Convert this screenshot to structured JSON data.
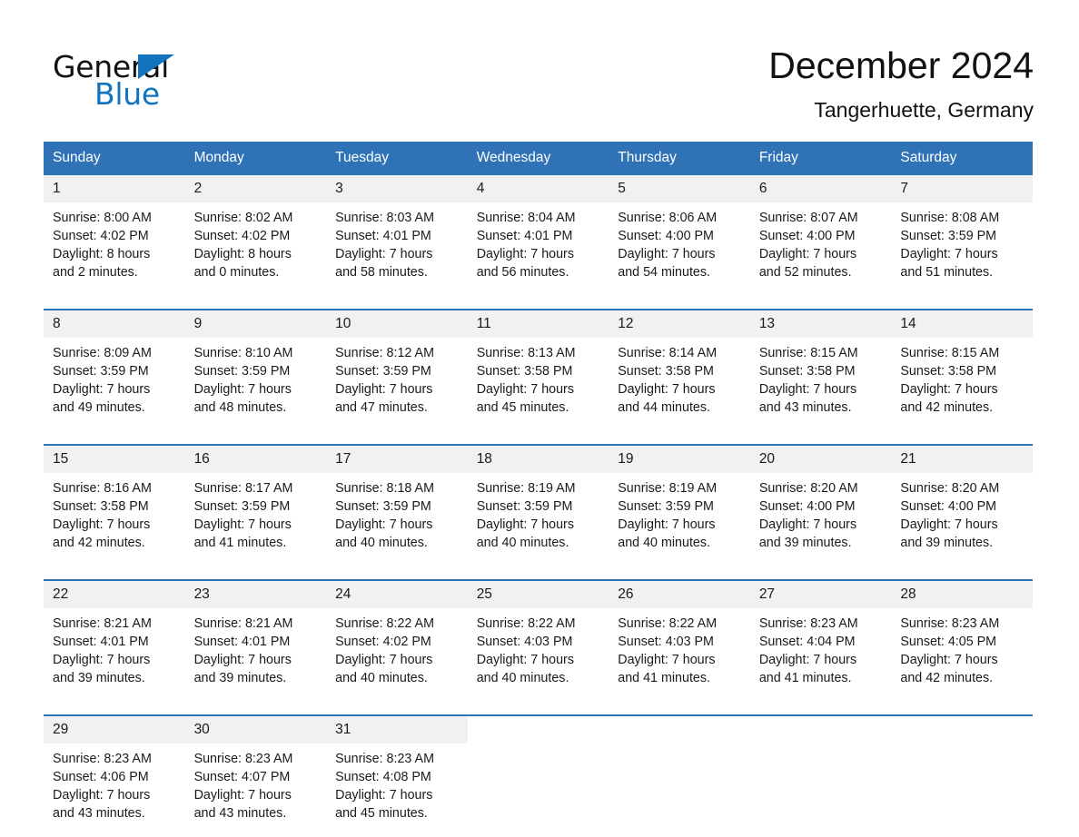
{
  "brand": {
    "name_top": "General",
    "name_bottom": "Blue",
    "triangle_color": "#1273be",
    "text_color": "#121212"
  },
  "header": {
    "title": "December 2024",
    "subtitle": "Tangerhuette, Germany"
  },
  "colors": {
    "header_blue": "#2f73b6",
    "daynum_band": "#f1f1f1",
    "text": "#1a1a1a",
    "page_background": "#ffffff"
  },
  "weekday_headers": [
    "Sunday",
    "Monday",
    "Tuesday",
    "Wednesday",
    "Thursday",
    "Friday",
    "Saturday"
  ],
  "weeks": [
    {
      "days": [
        {
          "num": "1",
          "sunrise": "Sunrise: 8:00 AM",
          "sunset": "Sunset: 4:02 PM",
          "daylight_1": "Daylight: 8 hours",
          "daylight_2": "and 2 minutes."
        },
        {
          "num": "2",
          "sunrise": "Sunrise: 8:02 AM",
          "sunset": "Sunset: 4:02 PM",
          "daylight_1": "Daylight: 8 hours",
          "daylight_2": "and 0 minutes."
        },
        {
          "num": "3",
          "sunrise": "Sunrise: 8:03 AM",
          "sunset": "Sunset: 4:01 PM",
          "daylight_1": "Daylight: 7 hours",
          "daylight_2": "and 58 minutes."
        },
        {
          "num": "4",
          "sunrise": "Sunrise: 8:04 AM",
          "sunset": "Sunset: 4:01 PM",
          "daylight_1": "Daylight: 7 hours",
          "daylight_2": "and 56 minutes."
        },
        {
          "num": "5",
          "sunrise": "Sunrise: 8:06 AM",
          "sunset": "Sunset: 4:00 PM",
          "daylight_1": "Daylight: 7 hours",
          "daylight_2": "and 54 minutes."
        },
        {
          "num": "6",
          "sunrise": "Sunrise: 8:07 AM",
          "sunset": "Sunset: 4:00 PM",
          "daylight_1": "Daylight: 7 hours",
          "daylight_2": "and 52 minutes."
        },
        {
          "num": "7",
          "sunrise": "Sunrise: 8:08 AM",
          "sunset": "Sunset: 3:59 PM",
          "daylight_1": "Daylight: 7 hours",
          "daylight_2": "and 51 minutes."
        }
      ]
    },
    {
      "days": [
        {
          "num": "8",
          "sunrise": "Sunrise: 8:09 AM",
          "sunset": "Sunset: 3:59 PM",
          "daylight_1": "Daylight: 7 hours",
          "daylight_2": "and 49 minutes."
        },
        {
          "num": "9",
          "sunrise": "Sunrise: 8:10 AM",
          "sunset": "Sunset: 3:59 PM",
          "daylight_1": "Daylight: 7 hours",
          "daylight_2": "and 48 minutes."
        },
        {
          "num": "10",
          "sunrise": "Sunrise: 8:12 AM",
          "sunset": "Sunset: 3:59 PM",
          "daylight_1": "Daylight: 7 hours",
          "daylight_2": "and 47 minutes."
        },
        {
          "num": "11",
          "sunrise": "Sunrise: 8:13 AM",
          "sunset": "Sunset: 3:58 PM",
          "daylight_1": "Daylight: 7 hours",
          "daylight_2": "and 45 minutes."
        },
        {
          "num": "12",
          "sunrise": "Sunrise: 8:14 AM",
          "sunset": "Sunset: 3:58 PM",
          "daylight_1": "Daylight: 7 hours",
          "daylight_2": "and 44 minutes."
        },
        {
          "num": "13",
          "sunrise": "Sunrise: 8:15 AM",
          "sunset": "Sunset: 3:58 PM",
          "daylight_1": "Daylight: 7 hours",
          "daylight_2": "and 43 minutes."
        },
        {
          "num": "14",
          "sunrise": "Sunrise: 8:15 AM",
          "sunset": "Sunset: 3:58 PM",
          "daylight_1": "Daylight: 7 hours",
          "daylight_2": "and 42 minutes."
        }
      ]
    },
    {
      "days": [
        {
          "num": "15",
          "sunrise": "Sunrise: 8:16 AM",
          "sunset": "Sunset: 3:58 PM",
          "daylight_1": "Daylight: 7 hours",
          "daylight_2": "and 42 minutes."
        },
        {
          "num": "16",
          "sunrise": "Sunrise: 8:17 AM",
          "sunset": "Sunset: 3:59 PM",
          "daylight_1": "Daylight: 7 hours",
          "daylight_2": "and 41 minutes."
        },
        {
          "num": "17",
          "sunrise": "Sunrise: 8:18 AM",
          "sunset": "Sunset: 3:59 PM",
          "daylight_1": "Daylight: 7 hours",
          "daylight_2": "and 40 minutes."
        },
        {
          "num": "18",
          "sunrise": "Sunrise: 8:19 AM",
          "sunset": "Sunset: 3:59 PM",
          "daylight_1": "Daylight: 7 hours",
          "daylight_2": "and 40 minutes."
        },
        {
          "num": "19",
          "sunrise": "Sunrise: 8:19 AM",
          "sunset": "Sunset: 3:59 PM",
          "daylight_1": "Daylight: 7 hours",
          "daylight_2": "and 40 minutes."
        },
        {
          "num": "20",
          "sunrise": "Sunrise: 8:20 AM",
          "sunset": "Sunset: 4:00 PM",
          "daylight_1": "Daylight: 7 hours",
          "daylight_2": "and 39 minutes."
        },
        {
          "num": "21",
          "sunrise": "Sunrise: 8:20 AM",
          "sunset": "Sunset: 4:00 PM",
          "daylight_1": "Daylight: 7 hours",
          "daylight_2": "and 39 minutes."
        }
      ]
    },
    {
      "days": [
        {
          "num": "22",
          "sunrise": "Sunrise: 8:21 AM",
          "sunset": "Sunset: 4:01 PM",
          "daylight_1": "Daylight: 7 hours",
          "daylight_2": "and 39 minutes."
        },
        {
          "num": "23",
          "sunrise": "Sunrise: 8:21 AM",
          "sunset": "Sunset: 4:01 PM",
          "daylight_1": "Daylight: 7 hours",
          "daylight_2": "and 39 minutes."
        },
        {
          "num": "24",
          "sunrise": "Sunrise: 8:22 AM",
          "sunset": "Sunset: 4:02 PM",
          "daylight_1": "Daylight: 7 hours",
          "daylight_2": "and 40 minutes."
        },
        {
          "num": "25",
          "sunrise": "Sunrise: 8:22 AM",
          "sunset": "Sunset: 4:03 PM",
          "daylight_1": "Daylight: 7 hours",
          "daylight_2": "and 40 minutes."
        },
        {
          "num": "26",
          "sunrise": "Sunrise: 8:22 AM",
          "sunset": "Sunset: 4:03 PM",
          "daylight_1": "Daylight: 7 hours",
          "daylight_2": "and 41 minutes."
        },
        {
          "num": "27",
          "sunrise": "Sunrise: 8:23 AM",
          "sunset": "Sunset: 4:04 PM",
          "daylight_1": "Daylight: 7 hours",
          "daylight_2": "and 41 minutes."
        },
        {
          "num": "28",
          "sunrise": "Sunrise: 8:23 AM",
          "sunset": "Sunset: 4:05 PM",
          "daylight_1": "Daylight: 7 hours",
          "daylight_2": "and 42 minutes."
        }
      ]
    },
    {
      "days": [
        {
          "num": "29",
          "sunrise": "Sunrise: 8:23 AM",
          "sunset": "Sunset: 4:06 PM",
          "daylight_1": "Daylight: 7 hours",
          "daylight_2": "and 43 minutes."
        },
        {
          "num": "30",
          "sunrise": "Sunrise: 8:23 AM",
          "sunset": "Sunset: 4:07 PM",
          "daylight_1": "Daylight: 7 hours",
          "daylight_2": "and 43 minutes."
        },
        {
          "num": "31",
          "sunrise": "Sunrise: 8:23 AM",
          "sunset": "Sunset: 4:08 PM",
          "daylight_1": "Daylight: 7 hours",
          "daylight_2": "and 45 minutes."
        },
        {
          "num": "",
          "sunrise": "",
          "sunset": "",
          "daylight_1": "",
          "daylight_2": ""
        },
        {
          "num": "",
          "sunrise": "",
          "sunset": "",
          "daylight_1": "",
          "daylight_2": ""
        },
        {
          "num": "",
          "sunrise": "",
          "sunset": "",
          "daylight_1": "",
          "daylight_2": ""
        },
        {
          "num": "",
          "sunrise": "",
          "sunset": "",
          "daylight_1": "",
          "daylight_2": ""
        }
      ]
    }
  ]
}
